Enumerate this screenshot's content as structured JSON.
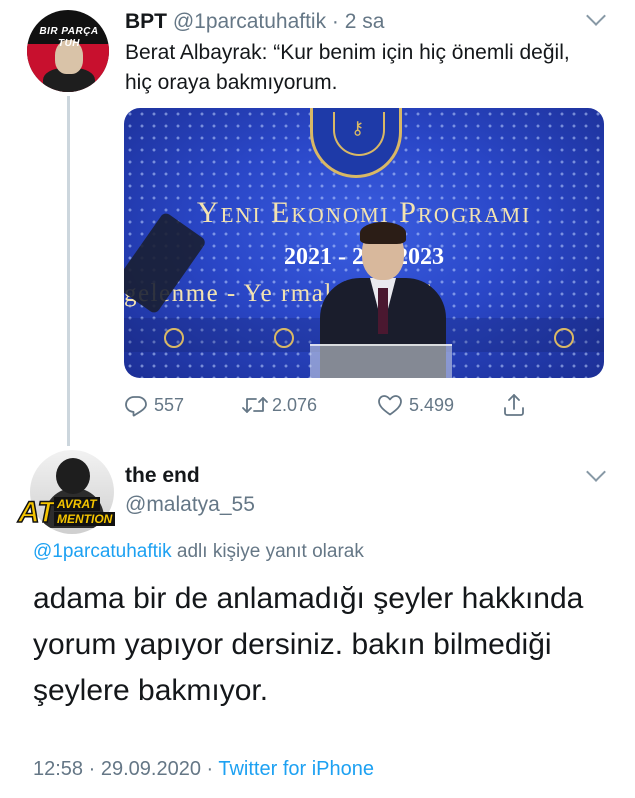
{
  "tweet1": {
    "avatar_text_line1": "BIR PARÇA",
    "avatar_text_line2": "TUH",
    "name": "BPT",
    "handle": "@1parcatuhaftik",
    "separator": "·",
    "time": "2 sa",
    "text": "Berat Albayrak: “Kur benim için hiç önemli değil, hiç oraya bakmıyorum.",
    "media": {
      "title": "Yeni Ekonomi Programı",
      "years": "2021 - 20    - 2023",
      "subtitle": "ngelenme - Ye          rmal - Yeni E"
    },
    "actions": {
      "replies": "557",
      "retweets": "2.076",
      "likes": "5.499"
    }
  },
  "tweet2": {
    "badge_at": "AT",
    "badge_line1": "AVRAT",
    "badge_line2": "MENTION",
    "name": "the end",
    "handle": "@malatya_55",
    "replying_mention": "@1parcatuhaftik",
    "replying_suffix": " adlı kişiye yanıt olarak",
    "text": "adama bir de anlamadığı şeyler hakkında yorum yapıyor dersiniz. bakın bilmediği şeylere bakmıyor.",
    "time": "12:58",
    "dot": " · ",
    "date": "29.09.2020",
    "source": "Twitter for iPhone"
  },
  "colors": {
    "link": "#1da1f2",
    "secondary_text": "#657786",
    "primary_text": "#14171a"
  },
  "icons": {
    "reply": "reply-icon",
    "retweet": "retweet-icon",
    "like": "heart-icon",
    "share": "share-icon",
    "menu": "chevron-down-icon"
  }
}
